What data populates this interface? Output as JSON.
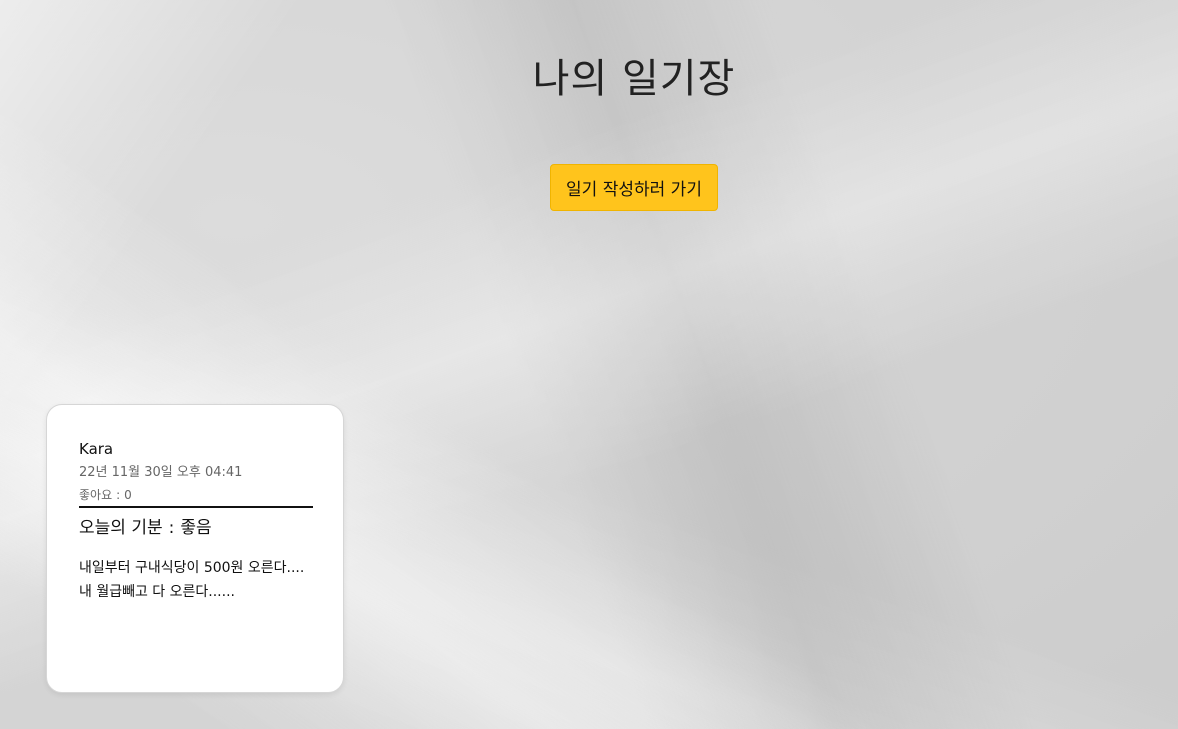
{
  "header": {
    "title": "나의 일기장"
  },
  "actions": {
    "write_label": "일기 작성하러 가기"
  },
  "diary_entries": [
    {
      "author": "Kara",
      "date": "22년 11월 30일 오후 04:41",
      "likes_label": "좋아요",
      "likes_separator": ":",
      "likes_count": "0",
      "mood_label": "오늘의 기분",
      "mood_separator": ":",
      "mood_value": "좋음",
      "content": "내일부터 구내식당이 500원 오른다.... 내 월급빼고 다 오른다......"
    }
  ],
  "colors": {
    "button_bg": "#ffc41c",
    "card_bg": "#ffffff",
    "paper_bg": "#e9e9e9"
  }
}
